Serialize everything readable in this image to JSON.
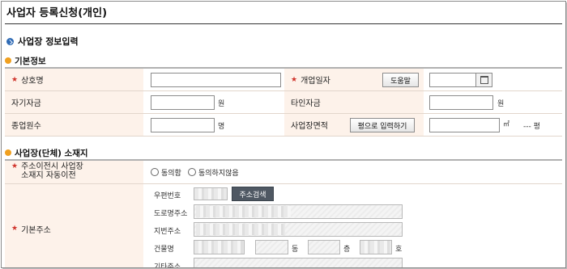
{
  "page": {
    "title": "사업자 등록신청(개인)"
  },
  "section": {
    "title": "사업장 정보입력"
  },
  "basic": {
    "title": "기본정보",
    "trade_name_label": "상호명",
    "open_date_label": "개업일자",
    "help_button": "도움말",
    "own_capital_label": "자기자금",
    "own_capital_unit": "원",
    "other_capital_label": "타인자금",
    "other_capital_unit": "원",
    "employees_label": "종업원수",
    "employees_unit": "명",
    "area_label": "사업장면적",
    "pyeong_button": "평으로 입력하기",
    "area_unit": "㎡",
    "pyeong_display": "--- 평"
  },
  "location": {
    "title": "사업장(단체) 소재지",
    "auto_move_label_1": "주소이전시 사업장",
    "auto_move_label_2": "소재지 자동이전",
    "agree_option": "동의함",
    "disagree_option": "동의하지않음",
    "base_address_label": "기본주소",
    "postal_code_label": "우편번호",
    "address_search_button": "주소검색",
    "road_address_label": "도로명주소",
    "lot_address_label": "지번주소",
    "building_label": "건물명",
    "dong_unit": "동",
    "floor_unit": "층",
    "ho_unit": "호",
    "other_address_label": "기타주소"
  },
  "colors": {
    "required": "#d0342c",
    "label_bg": "#fdf2ea",
    "section_icon": "#2f6bb5",
    "sub_icon": "#f0a020"
  }
}
